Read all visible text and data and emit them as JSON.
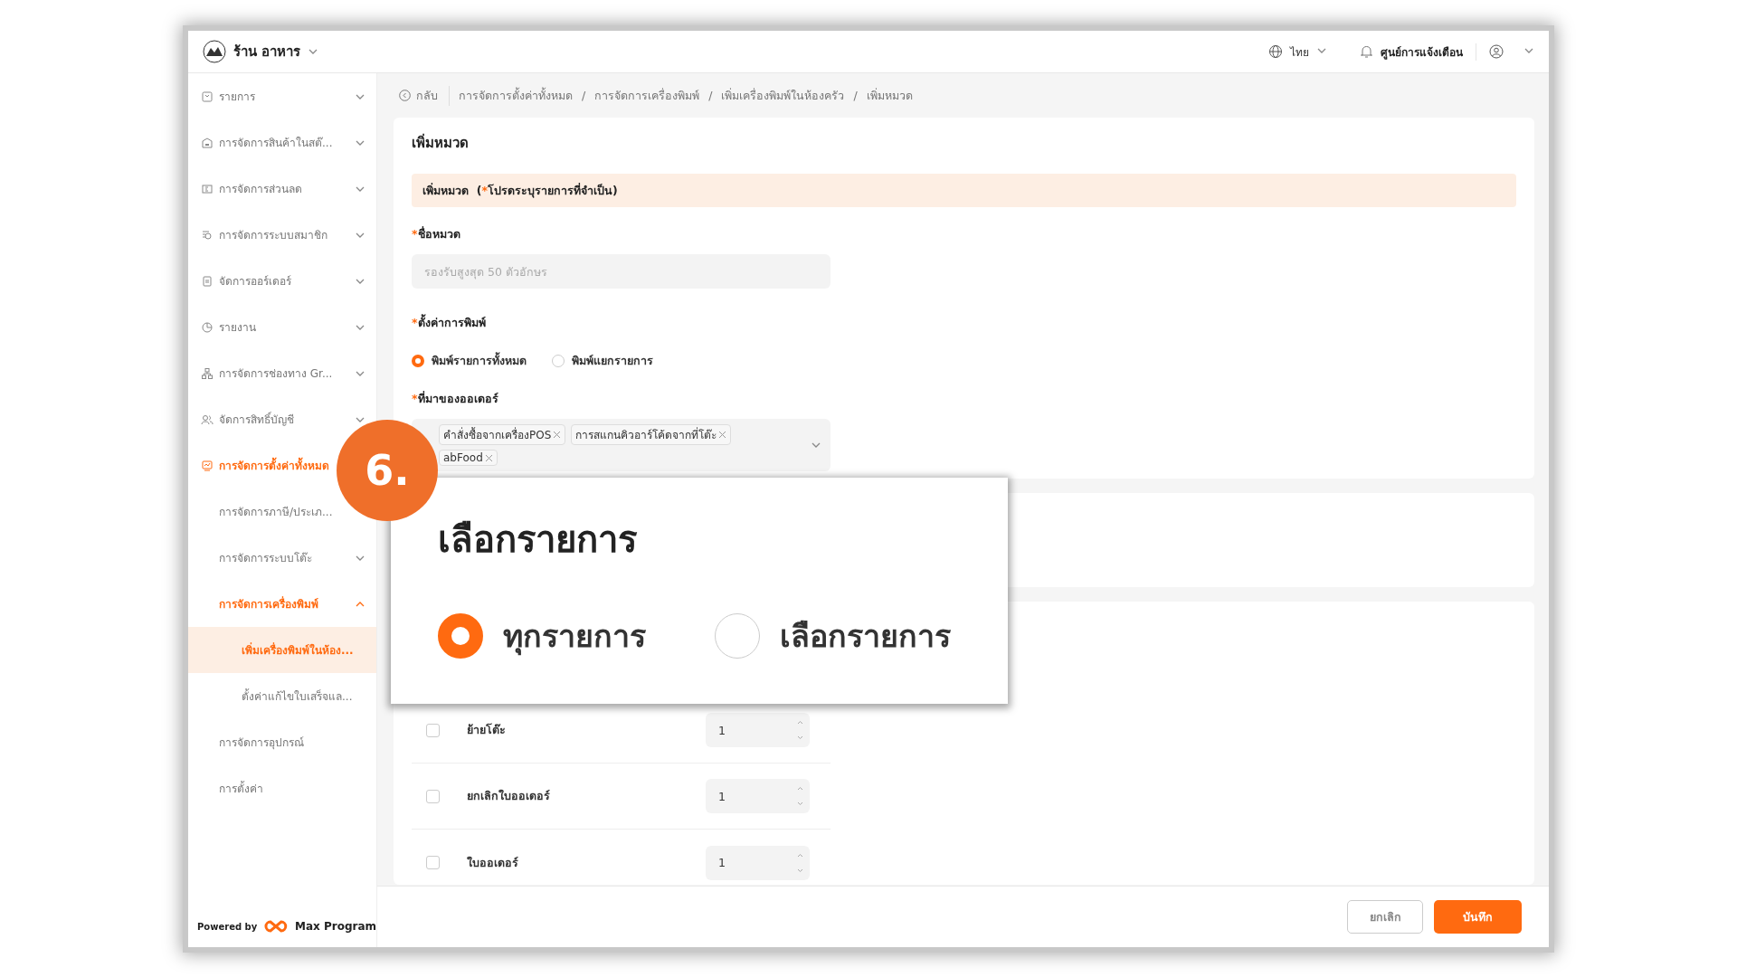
{
  "header": {
    "store_name": "ร้าน อาหาร",
    "language": "ไทย",
    "notifications": "ศูนย์การแจ้งเตือน"
  },
  "sidebar": {
    "items": [
      {
        "label": "รายการ",
        "selected": false,
        "expanded": false
      },
      {
        "label": "การจัดการสินค้าในสต๊...",
        "selected": false,
        "expanded": false
      },
      {
        "label": "การจัดการส่วนลด",
        "selected": false,
        "expanded": false
      },
      {
        "label": "การจัดการระบบสมาชิก",
        "selected": false,
        "expanded": false
      },
      {
        "label": "จัดการออร์เดอร์",
        "selected": false,
        "expanded": false
      },
      {
        "label": "รายงาน",
        "selected": false,
        "expanded": false
      },
      {
        "label": "การจัดการช่องทาง Gr...",
        "selected": false,
        "expanded": false
      },
      {
        "label": "จัดการสิทธิ์บัญชี",
        "selected": false,
        "expanded": false
      },
      {
        "label": "การจัดการตั้งค่าทั้งหมด",
        "selected": true,
        "children": [
          {
            "label": "การจัดการภาษี/ประเภ...",
            "selected": false
          },
          {
            "label": "การจัดการระบบโต๊ะ",
            "selected": false,
            "expanded": false
          },
          {
            "label": "การจัดการเครื่องพิมพ์",
            "selected": true,
            "expanded": true,
            "children": [
              {
                "label": "เพิ่มเครื่องพิมพ์ในห้อง...",
                "selected": true
              },
              {
                "label": "ตั้งค่าแก้ไขใบเสร็จแล...",
                "selected": false
              }
            ]
          },
          {
            "label": "การจัดการอุปกรณ์",
            "selected": false
          },
          {
            "label": "การตั้งค่า",
            "selected": false
          }
        ]
      }
    ],
    "powered_by": "Powered by",
    "brand": "Max Program"
  },
  "breadcrumb": {
    "back": "กลับ",
    "separator": "/",
    "items": [
      "การจัดการตั้งค่าทั้งหมด",
      "การจัดการเครื่องพิมพ์",
      "เพิ่มเครื่องพิมพ์ในห้องครัว",
      "เพิ่มหมวด"
    ]
  },
  "required_mark": "*",
  "form": {
    "title": "เพิ่มหมวด",
    "banner": {
      "title": "เพิ่มหมวด",
      "note_open": "(",
      "note": "โปรดระบุรายการที่จำเป็น)"
    },
    "fields": [
      {
        "kind": "text",
        "label": "ชื่อหมวด",
        "required": true,
        "placeholder": "รองรับสูงสุด 50 ตัวอักษร"
      },
      {
        "kind": "radio",
        "label": "ตั้งค่าการพิมพ์",
        "required": true,
        "options": [
          {
            "label": "พิมพ์รายการทั้งหมด",
            "selected": true
          },
          {
            "label": "พิมพ์แยกรายการ",
            "selected": false
          }
        ]
      },
      {
        "kind": "tags",
        "label": "ที่มาของออเดอร์",
        "required": true,
        "tags": [
          "คำสั่งซื้อจากเครื่องPOS",
          "การสแกนคิวอาร์โค้ดจากที่โต๊ะ",
          "abFood"
        ]
      }
    ]
  },
  "print_rows": [
    {
      "label": "ย้ายโต๊ะ",
      "checked": false,
      "copies": "1"
    },
    {
      "label": "ยกเลิกใบออเดอร์",
      "checked": false,
      "copies": "1"
    },
    {
      "label": "ใบออเดอร์",
      "checked": false,
      "copies": "1"
    }
  ],
  "buttons": [
    {
      "label": "ยกเลิก",
      "kind": "secondary"
    },
    {
      "label": "บันทึก",
      "kind": "primary"
    }
  ],
  "callout": {
    "step": "6.",
    "title": "เลือกรายการ",
    "options": [
      {
        "label": "ทุกรายการ",
        "selected": true
      },
      {
        "label": "เลือกรายการ",
        "selected": false
      }
    ]
  }
}
